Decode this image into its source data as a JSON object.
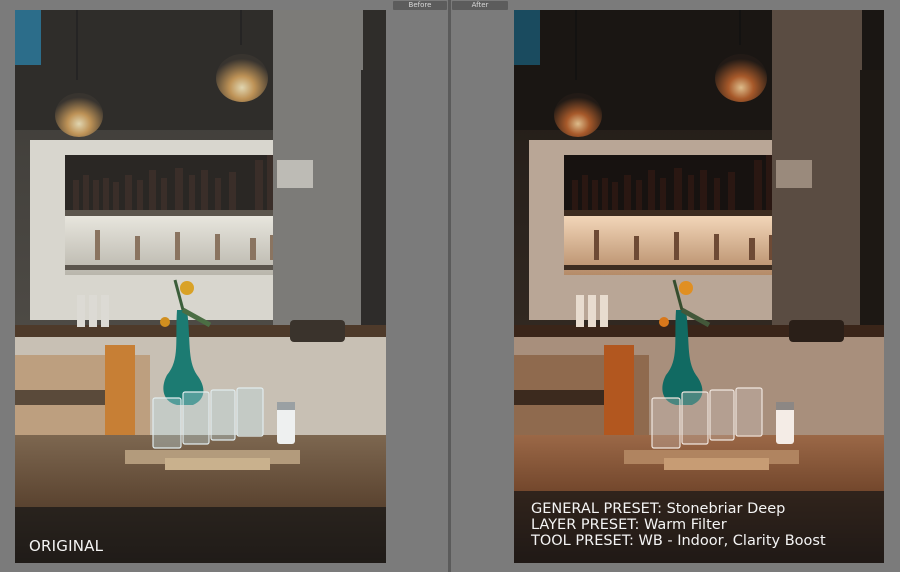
{
  "compare_view": {
    "before_tab_label": "Before",
    "after_tab_label": "After"
  },
  "left_panel": {
    "caption": "ORIGINAL"
  },
  "right_panel": {
    "caption_lines": [
      "GENERAL PRESET: Stonebriar Deep",
      "LAYER PRESET: Warm Filter",
      "TOOL PRESET: WB - Indoor, Clarity Boost"
    ]
  },
  "colors": {
    "workspace_background": "#7b7b7b",
    "tab_background": "#5c5c5c",
    "caption_overlay": "rgba(22,22,22,0.72)"
  }
}
